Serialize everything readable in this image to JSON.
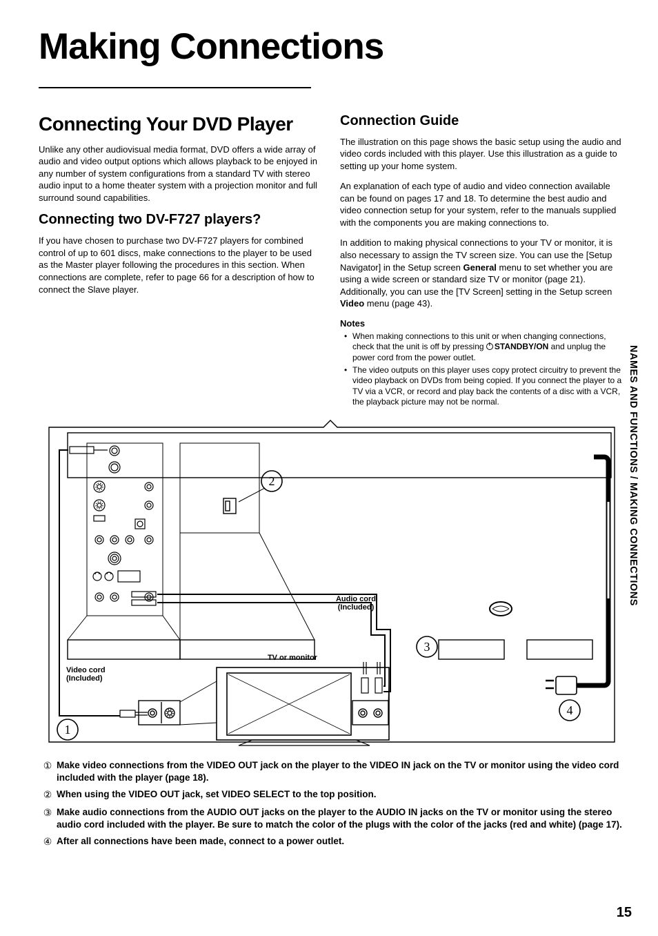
{
  "title": "Making Connections",
  "left": {
    "h2": "Connecting Your DVD Player",
    "p1": "Unlike any other audiovisual media format, DVD offers a wide array of audio and video output options which allows playback to be enjoyed in any number of system configurations from a standard TV with stereo audio input to a home theater system with a projection monitor and full surround sound capabilities.",
    "h3": "Connecting two DV-F727 players?",
    "p2": "If you have chosen to purchase two DV-F727 players for combined control of up to 601 discs, make connections to the player to be used as the Master player following the procedures in this section. When connections are complete, refer to page 66 for a description of how to connect the Slave player."
  },
  "right": {
    "h3": "Connection Guide",
    "p1": "The illustration on this page shows the basic setup using the audio and video cords included with this player. Use this illustration as a guide to setting up your home system.",
    "p2": "An explanation of each type of audio and video connection available can be found on pages 17 and 18. To determine the best audio and video connection setup for your system, refer to the manuals supplied with the components you are making connections to.",
    "p3_pre": "In addition to making physical connections to your TV or monitor, it is also necessary to assign the TV screen size. You can use the [Setup Navigator] in the Setup screen ",
    "p3_bold1": "General",
    "p3_mid": " menu to set whether you are using a wide screen or standard size TV or monitor (page 21). Additionally, you can use the [TV Screen] setting in the Setup screen ",
    "p3_bold2": "Video",
    "p3_post": " menu (page 43).",
    "notes_h": "Notes",
    "note1_pre": "When making connections to this unit or when changing connections, check that the unit is off by pressing ",
    "note1_bold": "STANDBY/ON",
    "note1_post": " and unplug the power cord from the power outlet.",
    "note2": "The video outputs on this player uses copy protect circuitry to prevent the video playback on DVDs from being copied. If you connect the player to a TV via a VCR, or record and play back the contents of a disc with a VCR, the playback picture may not be normal."
  },
  "diagram": {
    "audio_cord": "Audio cord (Included)",
    "video_cord": "Video cord (Included)",
    "tv": "TV or monitor",
    "c1": "1",
    "c2": "2",
    "c3": "3",
    "c4": "4"
  },
  "steps": [
    "Make video connections from the VIDEO OUT jack on the player to the VIDEO IN jack on the TV or monitor using the video cord included with the player (page 18).",
    "When using the VIDEO OUT jack, set VIDEO SELECT to the top position.",
    "Make audio connections from the AUDIO OUT jacks on the player to the AUDIO IN jacks on the TV or monitor using the stereo audio cord included with the player. Be sure to match the color of the plugs with the color of the jacks (red and white) (page 17).",
    "After all connections have been made, connect to a power outlet."
  ],
  "side": "NAMES AND FUNCTIONS / MAKING CONNECTIONS",
  "page": "15"
}
